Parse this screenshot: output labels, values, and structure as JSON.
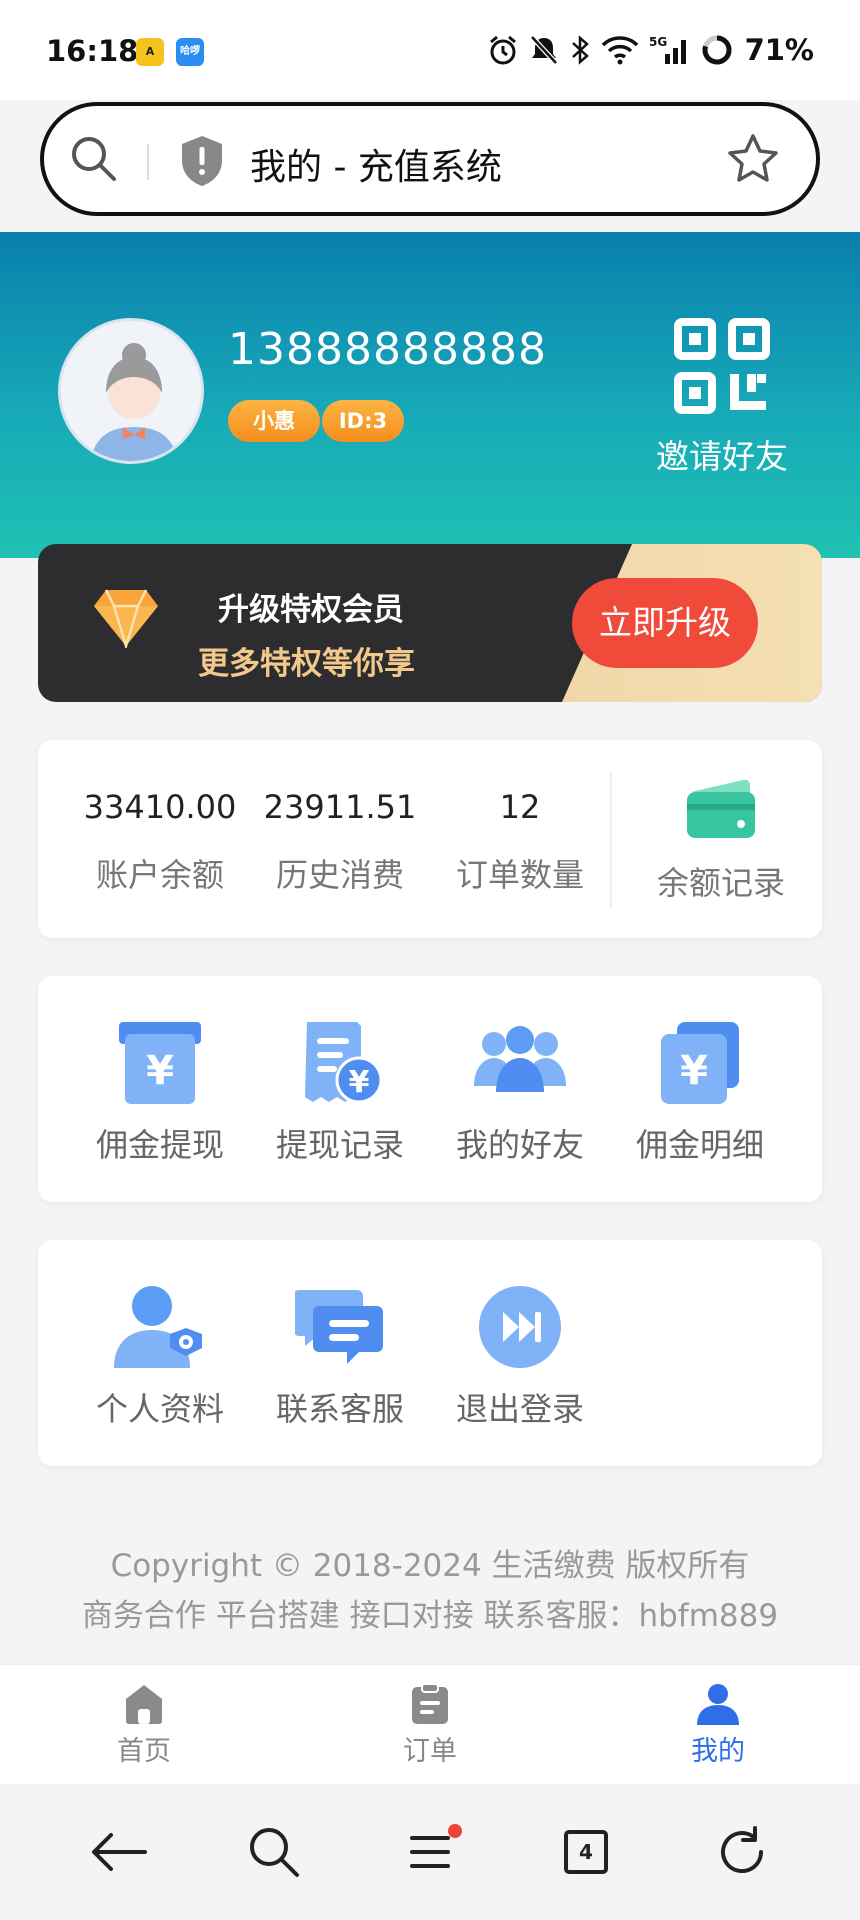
{
  "status_bar": {
    "time": "16:18",
    "app_badge_1": "A",
    "app_badge_2": "哈啰",
    "network": "5G",
    "battery": "71%"
  },
  "address_bar": {
    "title": "我的 - 充值系统"
  },
  "profile": {
    "phone": "13888888888",
    "level_badge": "小惠",
    "id_badge": "ID:3",
    "invite_label": "邀请好友"
  },
  "upgrade": {
    "title": "升级特权会员",
    "subtitle": "更多特权等你享",
    "button": "立即升级"
  },
  "stats": [
    {
      "value": "33410.00",
      "label": "账户余额"
    },
    {
      "value": "23911.51",
      "label": "历史消费"
    },
    {
      "value": "12",
      "label": "订单数量"
    }
  ],
  "balance_record": {
    "label": "余额记录"
  },
  "commission_menu": [
    {
      "label": "佣金提现",
      "icon": "commission-withdraw-icon"
    },
    {
      "label": "提现记录",
      "icon": "withdraw-record-icon"
    },
    {
      "label": "我的好友",
      "icon": "friends-icon"
    },
    {
      "label": "佣金明细",
      "icon": "commission-detail-icon"
    }
  ],
  "account_menu": [
    {
      "label": "个人资料",
      "icon": "profile-icon"
    },
    {
      "label": "联系客服",
      "icon": "customer-service-icon"
    },
    {
      "label": "退出登录",
      "icon": "logout-icon"
    }
  ],
  "footer": {
    "copyright": "Copyright © 2018-2024 生活缴费 版权所有",
    "business": "商务合作 平台搭建 接口对接 联系客服：hbfm889"
  },
  "tab_bar": [
    {
      "label": "首页",
      "icon": "home-icon",
      "active": false
    },
    {
      "label": "订单",
      "icon": "orders-icon",
      "active": false
    },
    {
      "label": "我的",
      "icon": "user-icon",
      "active": true
    }
  ],
  "browser_nav": {
    "tab_count": "4"
  },
  "colors": {
    "accent": "#2f6ee8",
    "header_start": "#0a7fad",
    "header_end": "#20c2b2",
    "upgrade_button": "#f04a3a",
    "badge": "#f7a02c",
    "icon_blue": "#5b9cf5"
  }
}
